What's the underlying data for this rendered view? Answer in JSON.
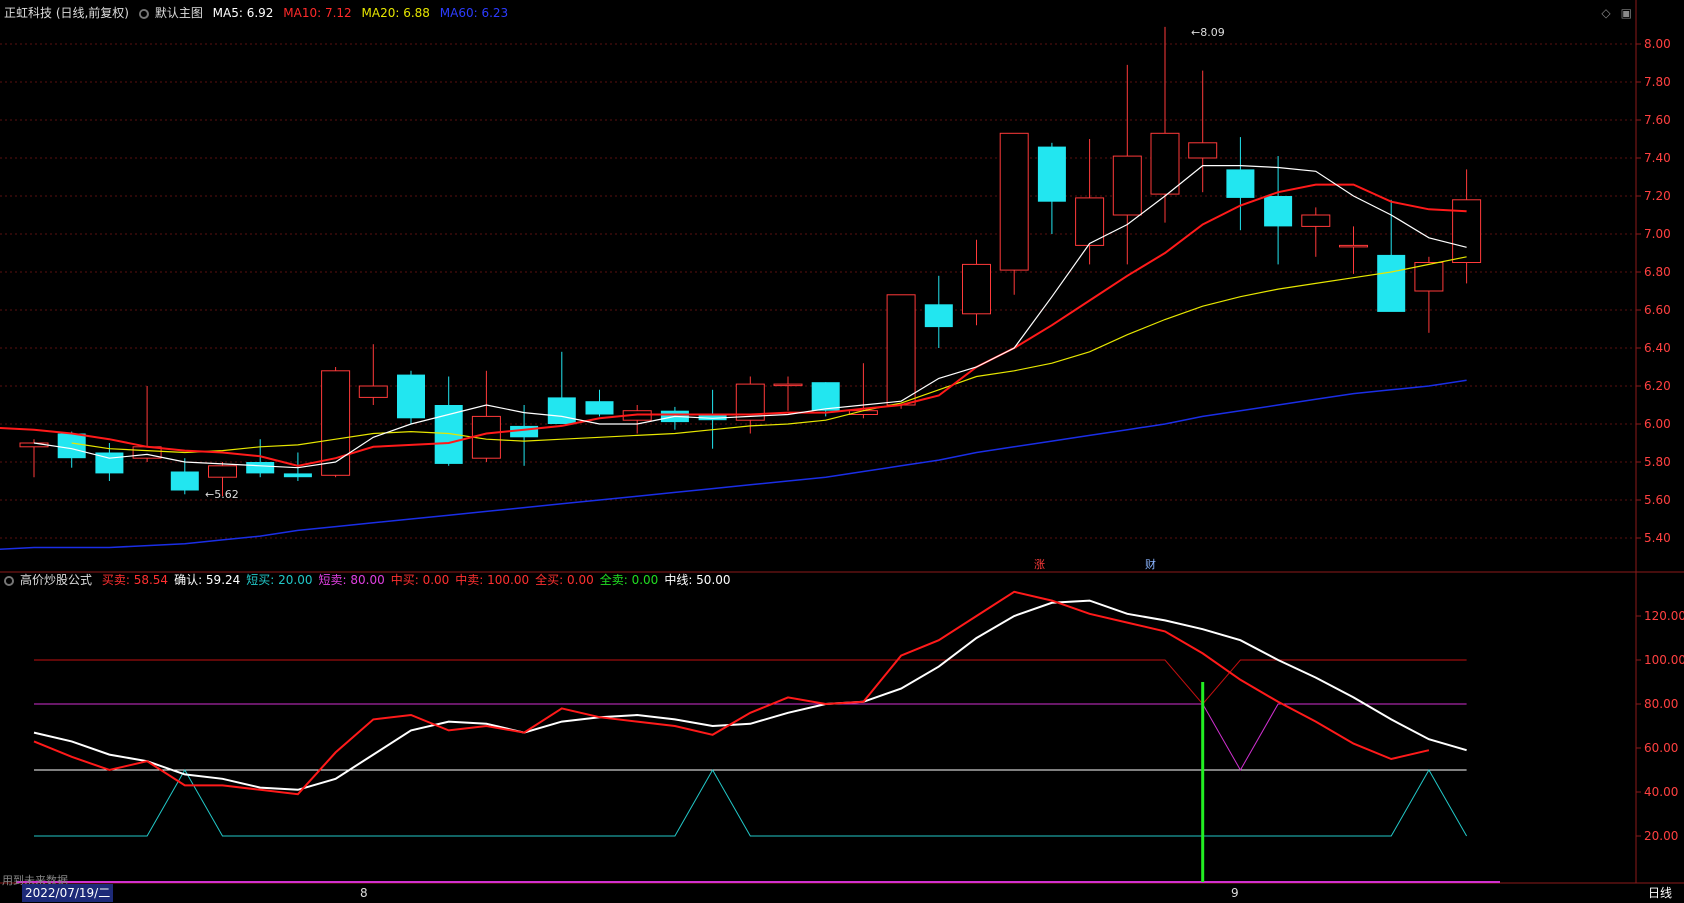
{
  "main_header": {
    "title": "正虹科技 (日线,前复权)",
    "template": "默认主图",
    "ma5": "MA5: 6.92",
    "ma10": "MA10: 7.12",
    "ma20": "MA20: 6.88",
    "ma60": "MA60: 6.23"
  },
  "indicator_header": {
    "name": "高价炒股公式",
    "values": [
      {
        "text": "买卖: 58.54",
        "color": "#ff3030"
      },
      {
        "text": "确认: 59.24",
        "color": "#ffffff"
      },
      {
        "text": "短买: 20.00",
        "color": "#22c8c8"
      },
      {
        "text": "短卖: 80.00",
        "color": "#e040e0"
      },
      {
        "text": "中买: 0.00",
        "color": "#ff3030"
      },
      {
        "text": "中卖: 100.00",
        "color": "#ff3030"
      },
      {
        "text": "全买: 0.00",
        "color": "#ff3030"
      },
      {
        "text": "全卖: 0.00",
        "color": "#22dd22"
      },
      {
        "text": "中线: 50.00",
        "color": "#ffffff"
      }
    ]
  },
  "price_axis": [
    "8.00",
    "7.80",
    "7.60",
    "7.40",
    "7.20",
    "7.00",
    "6.80",
    "6.60",
    "6.40",
    "6.20",
    "6.00",
    "5.80",
    "5.60",
    "5.40"
  ],
  "indicator_axis": [
    "120.00",
    "100.00",
    "80.00",
    "60.00",
    "40.00",
    "20.00"
  ],
  "annotations": {
    "high": "8.09",
    "low": "5.62",
    "zhang": "涨",
    "cai": "财"
  },
  "footer": {
    "date": "2022/07/19/二",
    "month_8": "8",
    "month_9": "9",
    "period": "日线",
    "future_note": "用到未来数据"
  },
  "colors": {
    "up": "#ff3a3a",
    "down": "#22e6f0",
    "ma5": "#ffffff",
    "ma10": "#ff1a1a",
    "ma20": "#e6e600",
    "ma60": "#1a2ee6"
  },
  "chart_data": [
    {
      "type": "candlestick",
      "ylim": [
        5.3,
        8.2
      ],
      "candles": [
        [
          5.88,
          5.92,
          5.72,
          5.9
        ],
        [
          5.95,
          5.96,
          5.77,
          5.82
        ],
        [
          5.85,
          5.9,
          5.7,
          5.74
        ],
        [
          5.82,
          6.2,
          5.8,
          5.88
        ],
        [
          5.75,
          5.82,
          5.63,
          5.65
        ],
        [
          5.72,
          5.8,
          5.62,
          5.78
        ],
        [
          5.8,
          5.92,
          5.72,
          5.74
        ],
        [
          5.74,
          5.85,
          5.7,
          5.72
        ],
        [
          5.73,
          6.3,
          5.72,
          6.28
        ],
        [
          6.14,
          6.42,
          6.1,
          6.2
        ],
        [
          6.26,
          6.28,
          6.0,
          6.03
        ],
        [
          6.1,
          6.25,
          5.78,
          5.79
        ],
        [
          5.82,
          6.28,
          5.8,
          6.04
        ],
        [
          5.99,
          6.1,
          5.78,
          5.93
        ],
        [
          6.14,
          6.38,
          6.02,
          6.0
        ],
        [
          6.12,
          6.18,
          6.04,
          6.05
        ],
        [
          6.02,
          6.1,
          5.95,
          6.07
        ],
        [
          6.07,
          6.09,
          5.97,
          6.01
        ],
        [
          6.05,
          6.18,
          5.87,
          6.02
        ],
        [
          6.02,
          6.25,
          5.95,
          6.21
        ],
        [
          6.21,
          6.25,
          6.07,
          6.21
        ],
        [
          6.22,
          6.22,
          6.04,
          6.07
        ],
        [
          6.05,
          6.32,
          6.03,
          6.07
        ],
        [
          6.1,
          6.68,
          6.08,
          6.68
        ],
        [
          6.63,
          6.78,
          6.4,
          6.51
        ],
        [
          6.58,
          6.97,
          6.52,
          6.84
        ],
        [
          6.81,
          7.52,
          6.68,
          7.53
        ],
        [
          7.46,
          7.48,
          7.0,
          7.17
        ],
        [
          6.94,
          7.5,
          6.84,
          7.19
        ],
        [
          7.1,
          7.89,
          6.84,
          7.41
        ],
        [
          7.21,
          8.09,
          7.06,
          7.53
        ],
        [
          7.4,
          7.86,
          7.22,
          7.48
        ],
        [
          7.34,
          7.51,
          7.02,
          7.19
        ],
        [
          7.2,
          7.41,
          6.84,
          7.04
        ],
        [
          7.04,
          7.14,
          6.88,
          7.1
        ],
        [
          6.94,
          7.04,
          6.79,
          6.94
        ],
        [
          6.89,
          7.18,
          6.6,
          6.59
        ],
        [
          6.7,
          6.88,
          6.48,
          6.85
        ],
        [
          6.85,
          7.34,
          6.74,
          7.18
        ]
      ],
      "ma5": [
        5.9,
        5.87,
        5.82,
        5.84,
        5.8,
        5.79,
        5.78,
        5.77,
        5.8,
        5.93,
        6.0,
        6.05,
        6.1,
        6.06,
        6.04,
        6.0,
        6.0,
        6.04,
        6.03,
        6.04,
        6.05,
        6.08,
        6.1,
        6.12,
        6.24,
        6.3,
        6.4,
        6.67,
        6.95,
        7.05,
        7.2,
        7.36,
        7.36,
        7.35,
        7.33,
        7.2,
        7.1,
        6.98,
        6.93
      ],
      "ma10": [
        5.98,
        5.97,
        5.95,
        5.92,
        5.88,
        5.86,
        5.85,
        5.83,
        5.78,
        5.82,
        5.88,
        5.89,
        5.9,
        5.95,
        5.97,
        5.99,
        6.03,
        6.05,
        6.05,
        6.05,
        6.05,
        6.06,
        6.06,
        6.08,
        6.1,
        6.15,
        6.3,
        6.4,
        6.52,
        6.65,
        6.78,
        6.9,
        7.05,
        7.15,
        7.22,
        7.26,
        7.26,
        7.17,
        7.13,
        7.12
      ],
      "ma20": [
        5.9,
        5.87,
        5.86,
        5.85,
        5.86,
        5.88,
        5.89,
        5.92,
        5.95,
        5.96,
        5.95,
        5.92,
        5.91,
        5.92,
        5.93,
        5.94,
        5.95,
        5.97,
        5.99,
        6.0,
        6.02,
        6.07,
        6.11,
        6.18,
        6.25,
        6.28,
        6.32,
        6.38,
        6.47,
        6.55,
        6.62,
        6.67,
        6.71,
        6.74,
        6.77,
        6.8,
        6.84,
        6.88
      ],
      "ma60": [
        5.34,
        5.35,
        5.35,
        5.35,
        5.36,
        5.37,
        5.39,
        5.41,
        5.44,
        5.46,
        5.48,
        5.5,
        5.52,
        5.54,
        5.56,
        5.58,
        5.6,
        5.62,
        5.64,
        5.66,
        5.68,
        5.7,
        5.72,
        5.75,
        5.78,
        5.81,
        5.85,
        5.88,
        5.91,
        5.94,
        5.97,
        6.0,
        6.04,
        6.07,
        6.1,
        6.13,
        6.16,
        6.18,
        6.2,
        6.23
      ]
    },
    {
      "type": "line",
      "title": "高价炒股公式",
      "ylim": [
        0,
        135
      ],
      "series": [
        {
          "name": "买卖",
          "values": [
            63,
            56,
            50,
            54,
            43,
            43,
            41,
            39,
            58,
            73,
            75,
            68,
            70,
            67,
            78,
            74,
            72,
            70,
            66,
            76,
            83,
            80,
            81,
            102,
            109,
            120,
            131,
            127,
            121,
            117,
            113,
            103,
            91,
            81,
            72,
            62,
            55,
            59
          ]
        },
        {
          "name": "确认",
          "values": [
            67,
            63,
            57,
            54,
            48,
            46,
            42,
            41,
            46,
            57,
            68,
            72,
            71,
            67,
            72,
            74,
            75,
            73,
            70,
            71,
            76,
            80,
            81,
            87,
            97,
            110,
            120,
            126,
            127,
            121,
            118,
            114,
            109,
            100,
            92,
            83,
            73,
            64,
            59
          ]
        },
        {
          "name": "短买",
          "values": [
            20,
            20,
            20,
            20,
            50,
            20,
            20,
            20,
            20,
            20,
            20,
            20,
            20,
            20,
            20,
            20,
            20,
            20,
            50,
            20,
            20,
            20,
            20,
            20,
            20,
            20,
            20,
            20,
            20,
            20,
            20,
            20,
            20,
            20,
            20,
            20,
            20,
            50,
            20
          ]
        },
        {
          "name": "短卖",
          "values": [
            80,
            80,
            80,
            80,
            80,
            80,
            80,
            80,
            80,
            80,
            80,
            80,
            80,
            80,
            80,
            80,
            80,
            80,
            80,
            80,
            80,
            80,
            80,
            80,
            80,
            80,
            80,
            80,
            80,
            80,
            80,
            80,
            50,
            80,
            80,
            80,
            80,
            80,
            80
          ]
        },
        {
          "name": "中卖",
          "values": [
            100,
            100,
            100,
            100,
            100,
            100,
            100,
            100,
            100,
            100,
            100,
            100,
            100,
            100,
            100,
            100,
            100,
            100,
            100,
            100,
            100,
            100,
            100,
            100,
            100,
            100,
            100,
            100,
            100,
            100,
            100,
            80,
            100,
            100,
            100,
            100,
            100,
            100,
            100
          ]
        },
        {
          "name": "中线",
          "values": [
            50,
            50,
            50,
            50,
            50,
            50,
            50,
            50,
            50,
            50,
            50,
            50,
            50,
            50,
            50,
            50,
            50,
            50,
            50,
            50,
            50,
            50,
            50,
            50,
            50,
            50,
            50,
            50,
            50,
            50,
            50,
            50,
            50,
            50,
            50,
            50,
            50,
            50,
            50
          ]
        }
      ],
      "bar_signal": {
        "index": 31,
        "value": 90
      }
    }
  ]
}
